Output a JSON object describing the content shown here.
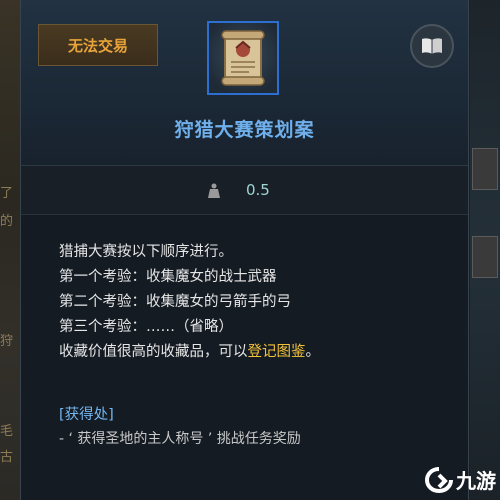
{
  "badge": {
    "label": "无法交易"
  },
  "item": {
    "name": "狩猎大赛策划案",
    "weight": "0.5"
  },
  "description": {
    "lines": [
      "猎捕大赛按以下顺序进行。",
      "第一个考验：收集魔女的战士武器",
      "第二个考验：收集魔女的弓箭手的弓",
      "第三个考验：……（省略）"
    ],
    "last_line_prefix": "收藏价值很高的收藏品，可以",
    "last_line_highlight": "登记图鉴",
    "last_line_suffix": "。"
  },
  "source": {
    "title": "[获得处]",
    "item": "- ‘ 获得圣地的主人称号 ’ 挑战任务奖励"
  },
  "background": {
    "left_fragments": [
      "了",
      "的",
      "狩",
      "毛",
      "古"
    ]
  },
  "watermark": {
    "text": "九游"
  },
  "colors": {
    "item_name": "#6fb0ec",
    "highlight": "#f2c23a",
    "badge_text": "#e8a43a",
    "slot_border": "#2d6fd0"
  },
  "icons": {
    "item": "scroll-icon",
    "codex": "book-icon",
    "weight": "weight-icon"
  }
}
